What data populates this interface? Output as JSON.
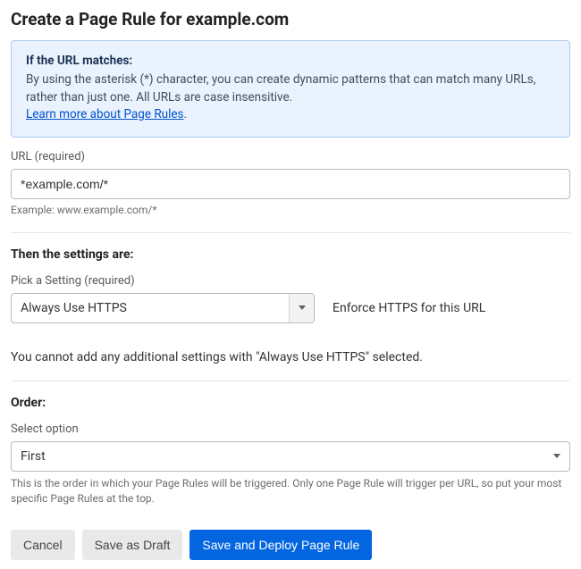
{
  "page": {
    "title": "Create a Page Rule for example.com"
  },
  "info": {
    "heading": "If the URL matches:",
    "body_line1": "By using the asterisk (*) character, you can create dynamic patterns that can match many URLs,",
    "body_line2": "rather than just one. All URLs are case insensitive.",
    "learn_more": "Learn more about Page Rules"
  },
  "url": {
    "label": "URL (required)",
    "value": "*example.com/*",
    "example": "Example: www.example.com/*"
  },
  "settings": {
    "heading": "Then the settings are:",
    "pick_label": "Pick a Setting (required)",
    "selected": "Always Use HTTPS",
    "description": "Enforce HTTPS for this URL",
    "note": "You cannot add any additional settings with \"Always Use HTTPS\" selected."
  },
  "order": {
    "heading": "Order:",
    "label": "Select option",
    "selected": "First",
    "help": "This is the order in which your Page Rules will be triggered. Only one Page Rule will trigger per URL, so put your most specific Page Rules at the top."
  },
  "buttons": {
    "cancel": "Cancel",
    "draft": "Save as Draft",
    "deploy": "Save and Deploy Page Rule"
  }
}
